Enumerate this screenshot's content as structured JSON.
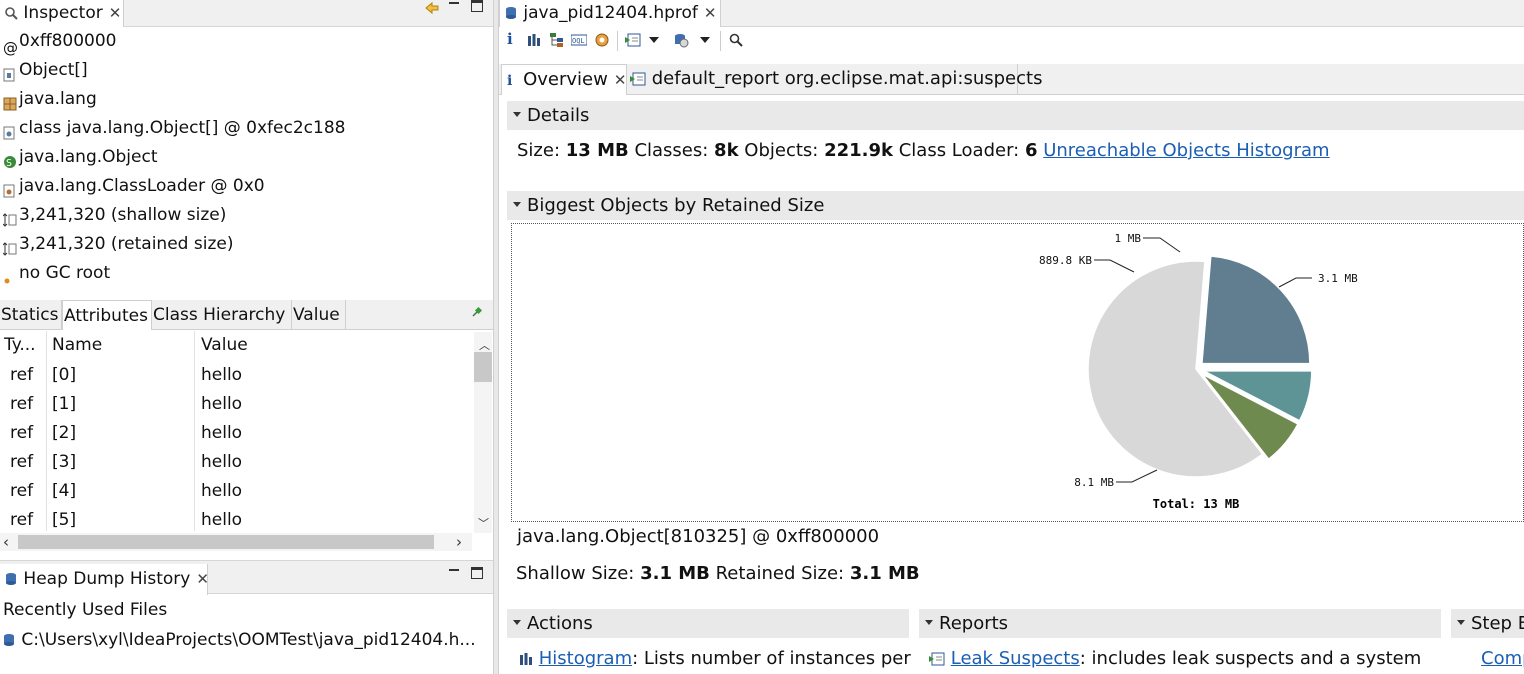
{
  "inspector": {
    "tab_label": "Inspector",
    "rows": [
      {
        "icon": "address-icon",
        "text": "0xff800000"
      },
      {
        "icon": "array-icon",
        "text": "Object[]"
      },
      {
        "icon": "package-icon",
        "text": "java.lang"
      },
      {
        "icon": "class-icon",
        "text": "class java.lang.Object[] @ 0xfec2c188"
      },
      {
        "icon": "superclass-icon",
        "text": "java.lang.Object"
      },
      {
        "icon": "classloader-icon",
        "text": "java.lang.ClassLoader @ 0x0"
      },
      {
        "icon": "size-icon",
        "text": "3,241,320 (shallow size)"
      },
      {
        "icon": "size-icon",
        "text": "3,241,320 (retained size)"
      },
      {
        "icon": "gc-root-icon",
        "text": "no GC root"
      }
    ],
    "subtabs": [
      "Statics",
      "Attributes",
      "Class Hierarchy",
      "Value"
    ],
    "active_subtab": "Attributes",
    "table": {
      "headers": [
        "Ty...",
        "Name",
        "Value"
      ],
      "rows": [
        {
          "type": "ref",
          "name": "[0]",
          "value": "hello"
        },
        {
          "type": "ref",
          "name": "[1]",
          "value": "hello"
        },
        {
          "type": "ref",
          "name": "[2]",
          "value": "hello"
        },
        {
          "type": "ref",
          "name": "[3]",
          "value": "hello"
        },
        {
          "type": "ref",
          "name": "[4]",
          "value": "hello"
        },
        {
          "type": "ref",
          "name": "[5]",
          "value": "hello"
        }
      ]
    }
  },
  "heap_history": {
    "tab_label": "Heap Dump History",
    "heading": "Recently Used Files",
    "files": [
      "C:\\Users\\xyl\\IdeaProjects\\OOMTest\\java_pid12404.h..."
    ]
  },
  "editor": {
    "tab_label": "java_pid12404.hprof",
    "subtabs": [
      {
        "label": "Overview",
        "icon": "info-icon"
      },
      {
        "label": "default_report org.eclipse.mat.api:suspects",
        "icon": "report-icon"
      }
    ],
    "details": {
      "title": "Details",
      "size_label": "Size:",
      "size_value": "13 MB",
      "classes_label": "Classes:",
      "classes_value": "8k",
      "objects_label": "Objects:",
      "objects_value": "221.9k",
      "loader_label": "Class Loader:",
      "loader_value": "6",
      "link": "Unreachable Objects Histogram"
    },
    "biggest": {
      "title": "Biggest Objects by Retained Size",
      "object_name": "java.lang.Object[810325] @ 0xff800000",
      "shallow_label": "Shallow Size:",
      "shallow_value": "3.1 MB",
      "retained_label": "Retained Size:",
      "retained_value": "3.1 MB"
    },
    "sections": {
      "actions": "Actions",
      "reports": "Reports",
      "step": "Step B"
    },
    "actions_item": {
      "link": "Histogram",
      "text": ": Lists number of instances per"
    },
    "reports_item": {
      "link": "Leak Suspects",
      "text": ": includes leak suspects and a system"
    },
    "step_item": {
      "link": "Comp"
    }
  },
  "chart_data": {
    "type": "pie",
    "values": [
      3.1,
      8.1,
      0.8898,
      1.0
    ],
    "labels": [
      "3.1 MB",
      "8.1 MB",
      "889.8 KB",
      "1 MB"
    ],
    "colors": [
      "#607e8f",
      "#d8d8d8",
      "#6e8a4e",
      "#5f9497"
    ],
    "exploded": [
      true,
      false,
      true,
      true
    ],
    "total_label": "Total: 13 MB"
  }
}
